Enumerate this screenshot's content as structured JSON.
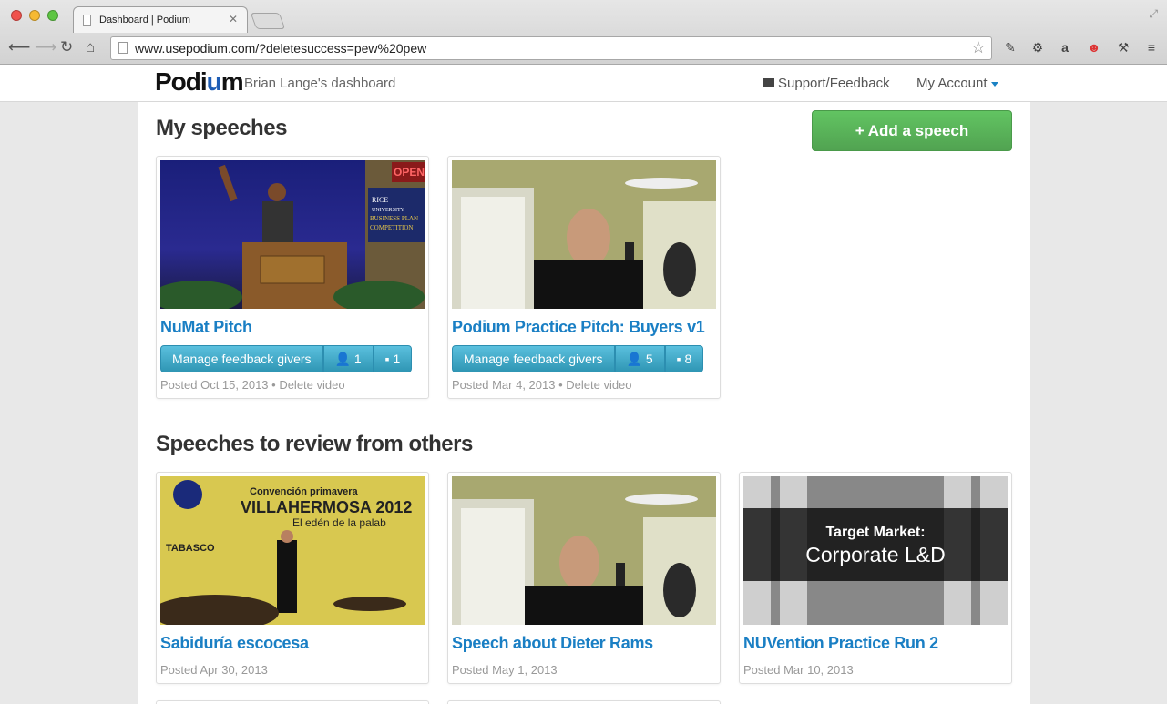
{
  "browser": {
    "tab_title": "Dashboard | Podium",
    "url": "www.usepodium.com/?deletesuccess=pew%20pew"
  },
  "header": {
    "logo_prefix": "Podi",
    "logo_u": "u",
    "logo_suffix": "m",
    "dashboard_title": "Brian Lange's dashboard",
    "support_label": "Support/Feedback",
    "account_label": "My Account"
  },
  "my_speeches": {
    "heading": "My speeches",
    "add_label": "+ Add a speech",
    "items": [
      {
        "title": "NuMat Pitch",
        "manage_label": "Manage feedback givers",
        "givers": "1",
        "comments": "1",
        "posted": "Posted Oct 15, 2013",
        "delete_label": "Delete video"
      },
      {
        "title": "Podium Practice Pitch: Buyers v1",
        "manage_label": "Manage feedback givers",
        "givers": "5",
        "comments": "8",
        "posted": "Posted Mar 4, 2013",
        "delete_label": "Delete video"
      }
    ]
  },
  "review": {
    "heading": "Speeches to review from others",
    "items": [
      {
        "title": "Sabiduría escocesa",
        "posted": "Posted Apr 30, 2013"
      },
      {
        "title": "Speech about Dieter Rams",
        "posted": "Posted May 1, 2013"
      },
      {
        "title": "NUVention Practice Run 2",
        "posted": "Posted Mar 10, 2013"
      }
    ]
  },
  "thumb_text": {
    "rice_1": "RICE",
    "rice_2": "UNIVERSITY",
    "rice_3": "BUSINESS PLAN",
    "rice_4": "COMPETITION",
    "open": "OPEN",
    "villa_1": "Convención primavera",
    "villa_2": "VILLAHERMOSA 2012",
    "villa_3": "El edén de la palab",
    "tabasco": "TABASCO",
    "target_1": "Target Market:",
    "target_2": "Corporate L&D"
  },
  "colors": {
    "link": "#1a7fc4",
    "add_button": "#5cb85c",
    "info_button": "#3fa9d0"
  }
}
